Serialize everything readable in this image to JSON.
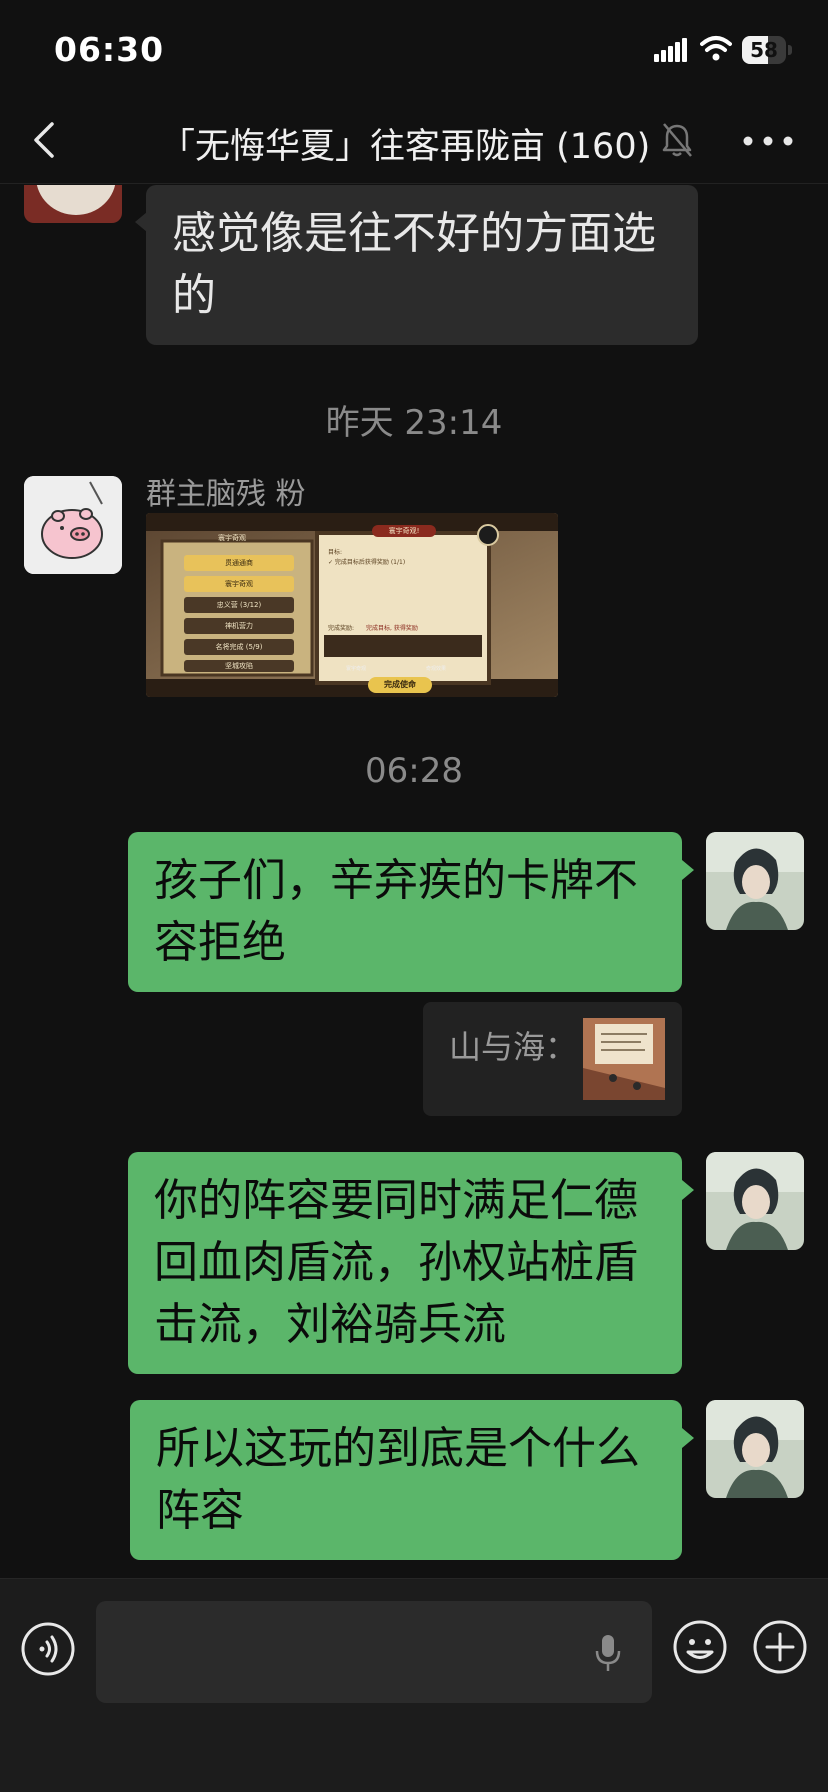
{
  "status_bar": {
    "time": "06:30",
    "battery": "58",
    "battery_level": 0.58
  },
  "nav": {
    "title": "「无悔华夏」往客再陇亩 (160)"
  },
  "messages": {
    "m1": {
      "text": "感觉像是往不好的方面选的"
    },
    "ts1": "昨天 23:14",
    "m2": {
      "sender": "群主脑残 粉",
      "panel_title": "寰宇奇观",
      "list_items": [
        "贯通通商",
        "寰宇奇观",
        "忠义营 (3/12)",
        "神机营力",
        "名将完成 (5/9)",
        "坚城攻陷"
      ],
      "dialog_title": "寰宇奇观!",
      "goal_label": "目标:",
      "goal_text": "✓ 完成目标后获得奖励 (1/1)",
      "reward_label": "完成奖励:",
      "reward_text": "完成目标, 获得奖励",
      "reward1": "寰宇奇观",
      "reward2": "奇观效果",
      "complete_button": "完成使命"
    },
    "ts2": "06:28",
    "m3": {
      "text": "孩子们，辛弃疾的卡牌不容拒绝"
    },
    "m4": {
      "quote_author": "山与海："
    },
    "m5": {
      "text": "你的阵容要同时满足仁德回血肉盾流，孙权站桩盾击流，刘裕骑兵流"
    },
    "m6": {
      "text": "所以这玩的到底是个什么阵容"
    }
  },
  "input": {
    "placeholder": ""
  },
  "colors": {
    "background": "#111111",
    "bubble_out": "#5bb66a",
    "bubble_in": "#2c2c2c",
    "timestamp": "#8a8a8a"
  },
  "icons": [
    "back-icon",
    "mute-icon",
    "more-icon",
    "voice-icon",
    "mic-icon",
    "emoji-icon",
    "plus-icon",
    "signal-icon",
    "wifi-icon"
  ]
}
